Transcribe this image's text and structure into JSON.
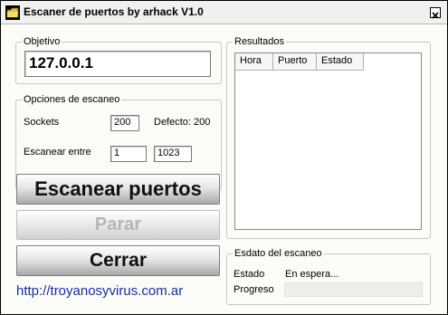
{
  "window": {
    "title": "Escaner de puertos by arhack V1.0"
  },
  "objetivo": {
    "label": "Objetivo",
    "value": "127.0.0.1"
  },
  "opciones": {
    "label": "Opciones de escaneo",
    "sockets_label": "Sockets",
    "sockets_value": "200",
    "defecto_text": "Defecto: 200",
    "range_label": "Escanear entre",
    "range_start": "1",
    "range_end": "1023"
  },
  "buttons": {
    "scan": "Escanear puertos",
    "stop": "Parar",
    "close": "Cerrar"
  },
  "link": "http://troyanosyvirus.com.ar",
  "resultados": {
    "label": "Resultados",
    "columns": [
      "Hora",
      "Puerto",
      "Estado"
    ]
  },
  "estado": {
    "label": "Esdato del escaneo",
    "estado_label": "Estado",
    "estado_value": "En espera...",
    "progreso_label": "Progreso",
    "progress": 0
  },
  "colors": {
    "link": "#1c2f99",
    "disabled_text": "#b6b6b6"
  }
}
